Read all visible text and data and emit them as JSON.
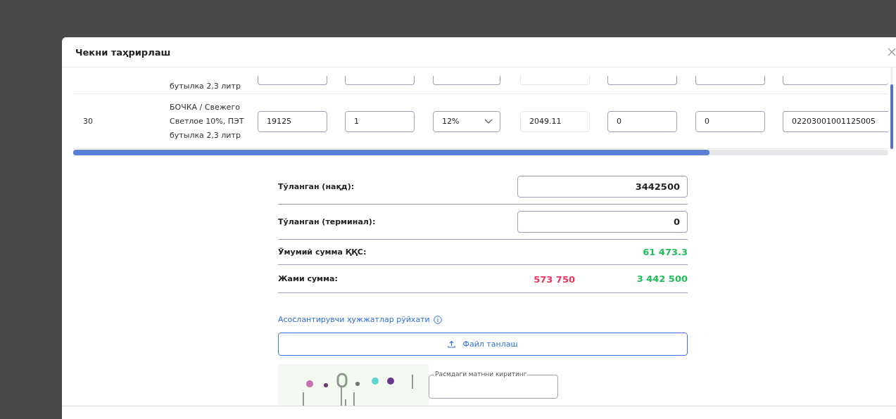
{
  "dialog": {
    "title": "Чекни таҳрирлаш"
  },
  "table": {
    "rows": [
      {
        "kind": "partial",
        "name": "бутылка 2,3 литр"
      },
      {
        "kind": "full",
        "number": "30",
        "name": "БОЧКА / Свежего Светлое 10%, ПЭТ бутылка 2,3 литр",
        "price": "19125",
        "quantity": "1",
        "vat": "12%",
        "sum": "2049.11",
        "column_7": "0",
        "column_8": "0",
        "code": "02203001001125005"
      }
    ]
  },
  "summary": {
    "rows": [
      {
        "kind": "input",
        "label": "Тўланган (нақд):",
        "value": "3442500"
      },
      {
        "kind": "input",
        "label": "Тўланган (терминал):",
        "value": "0"
      },
      {
        "kind": "amount",
        "label": "Ўмумий сумма ҚҚС:",
        "value": "61 473.3"
      },
      {
        "kind": "amount",
        "label": "Жами сумма:",
        "extra": "573 750",
        "value": "3 442 500"
      }
    ]
  },
  "documents_link": "Асослантирувчи ҳужжатлар рўйхати",
  "upload_button": "Файл танлаш",
  "captcha": {
    "label": "Расмдаги матнни киритинг"
  }
}
